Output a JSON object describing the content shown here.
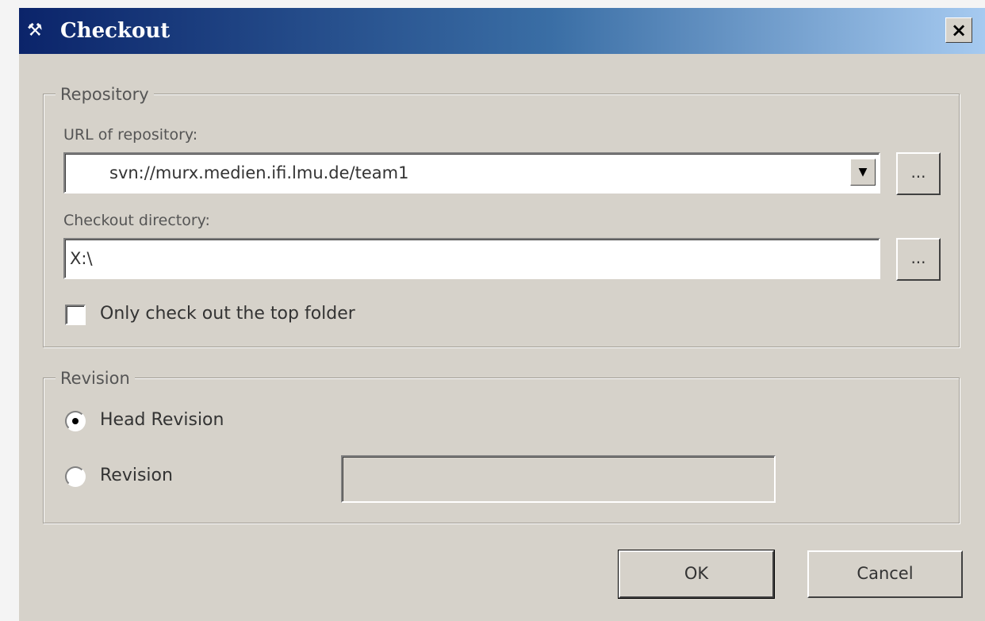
{
  "window": {
    "title": "Checkout",
    "close_label": "×"
  },
  "repository_group": {
    "legend": "Repository",
    "url_label": "URL of repository:",
    "url_value": "svn://murx.medien.ifi.lmu.de/team1",
    "url_browse_label": "...",
    "dir_label": "Checkout directory:",
    "dir_value": "X:\\",
    "dir_browse_label": "...",
    "top_folder_label": "Only check out the top folder",
    "top_folder_checked": false
  },
  "revision_group": {
    "legend": "Revision",
    "head_label": "Head Revision",
    "head_selected": true,
    "revision_label": "Revision",
    "revision_selected": false,
    "revision_value": ""
  },
  "buttons": {
    "ok_label": "OK",
    "cancel_label": "Cancel"
  }
}
